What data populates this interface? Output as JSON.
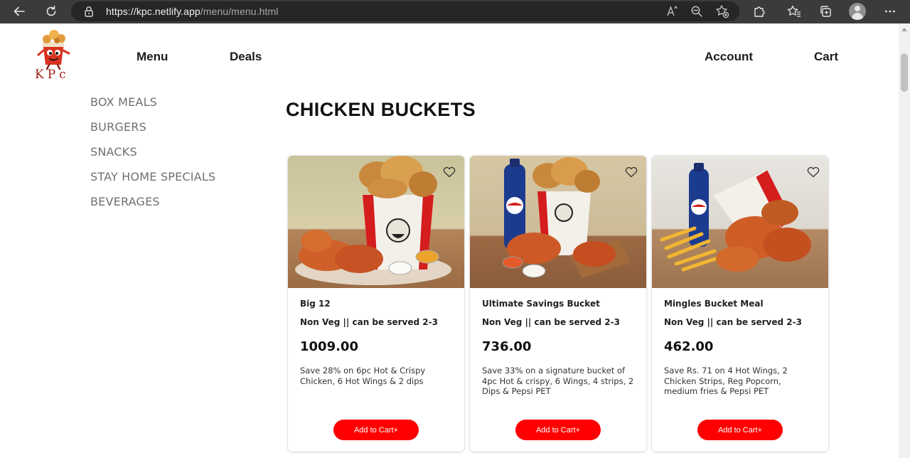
{
  "browser": {
    "url_host": "https://kpc.netlify.app",
    "url_path": "/menu/menu.html",
    "icons": [
      "back-arrow-icon",
      "refresh-icon",
      "lock-icon",
      "read-aloud-icon",
      "zoom-out-icon",
      "favorite-add-icon",
      "extensions-icon",
      "favorites-icon",
      "collections-icon",
      "profile-icon",
      "more-icon"
    ]
  },
  "header": {
    "logo_text": "KPc",
    "nav": {
      "menu": "Menu",
      "deals": "Deals",
      "account": "Account",
      "cart": "Cart"
    }
  },
  "sidebar": {
    "items": [
      {
        "label": "BOX MEALS"
      },
      {
        "label": "BURGERS"
      },
      {
        "label": "SNACKS"
      },
      {
        "label": "STAY HOME SPECIALS"
      },
      {
        "label": "BEVERAGES"
      }
    ]
  },
  "main": {
    "title": "CHICKEN BUCKETS",
    "products": [
      {
        "name": "Big 12",
        "subtitle": "Non Veg || can be served 2-3",
        "price": "1009.00",
        "description": "Save 28% on 6pc Hot & Crispy Chicken, 6 Hot Wings & 2 dips",
        "button": "Add to Cart+"
      },
      {
        "name": "Ultimate Savings Bucket",
        "subtitle": "Non Veg || can be served 2-3",
        "price": "736.00",
        "description": "Save 33% on a signature bucket of 4pc Hot & crispy, 6 Wings, 4 strips, 2 Dips & Pepsi PET",
        "button": "Add to Cart+"
      },
      {
        "name": "Mingles Bucket Meal",
        "subtitle": "Non Veg || can be served 2-3",
        "price": "462.00",
        "description": "Save Rs. 71 on 4 Hot Wings, 2 Chicken Strips, Reg Popcorn, medium fries & Pepsi PET",
        "button": "Add to Cart+"
      }
    ]
  },
  "colors": {
    "accent": "#ff0000",
    "chrome_bg": "#3b3b3b",
    "sidebar_text": "#707070"
  }
}
